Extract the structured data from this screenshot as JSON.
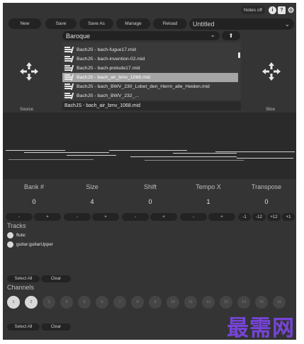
{
  "header": {
    "notes_toggle": "Notes off",
    "info_icon": "info-icon",
    "help_icon": "help-icon",
    "settings_icon": "gear-icon"
  },
  "toolbar": {
    "new_label": "New",
    "save_label": "Save",
    "save_as_label": "Save As",
    "manage_label": "Manage",
    "reload_label": "Reload",
    "preset_name": "Untitled"
  },
  "browser": {
    "folder": "Baroque",
    "files": [
      "BachJS - bach-fugue17.mid",
      "BachJS - bach-invention-02.mid",
      "BachJS - bach-prelude17.mid",
      "BachJS - bach_air_bmv_1068.mid",
      "BachJS - bach_BWV_230_Lobet_den_Herrn_alle_Heiden.mid",
      "BachJS - bach_BWV_232_..."
    ],
    "selected_index": 3,
    "current_file": "BachJS - bach_air_bmv_1068.mid",
    "source_label": "Source",
    "slice_label": "Slice"
  },
  "params": {
    "labels": [
      "Bank #",
      "Size",
      "Shift",
      "Tempo X",
      "Transpose"
    ],
    "values": [
      "0",
      "4",
      "0",
      "1",
      "0"
    ],
    "minus": "-",
    "plus": "+",
    "transpose_steps": [
      "-1",
      "-12",
      "+12",
      "+1"
    ]
  },
  "tracks": {
    "title": "Tracks",
    "items": [
      "flute:",
      "guitar:guitarUpper"
    ],
    "select_all": "Select All",
    "clear": "Clear"
  },
  "channels": {
    "title": "Channels",
    "numbers": [
      "1",
      "2",
      "3",
      "4",
      "5",
      "6",
      "7",
      "8",
      "9",
      "10",
      "11",
      "12",
      "13",
      "14",
      "15",
      "16"
    ],
    "active": [
      0,
      1
    ],
    "select_all": "Select All",
    "clear": "Clear"
  },
  "watermark": "最需网",
  "colors": {
    "panel": "#343434",
    "button": "#232323",
    "selection": "#a5a5a5",
    "watermark": "#7a45e0"
  }
}
